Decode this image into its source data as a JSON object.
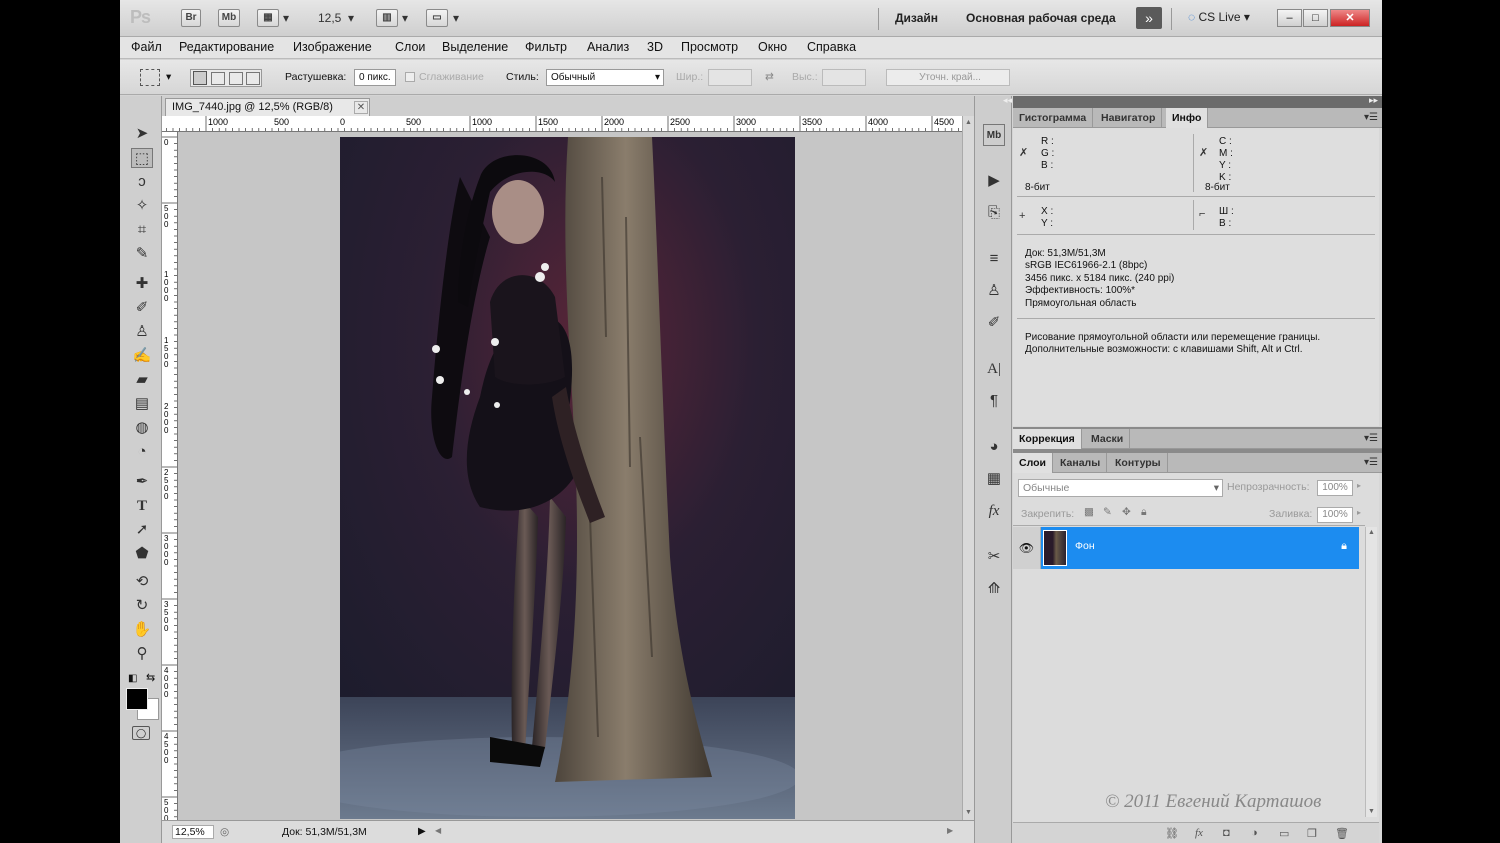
{
  "app": {
    "logo": "Ps",
    "bridge_label": "Br",
    "minibridge_label": "Mb",
    "zoom_dropdown": "12,5",
    "workspace_design": "Дизайн",
    "workspace_main": "Основная рабочая среда",
    "cslive_label": "CS Live"
  },
  "menu": [
    "Файл",
    "Редактирование",
    "Изображение",
    "Слои",
    "Выделение",
    "Фильтр",
    "Анализ",
    "3D",
    "Просмотр",
    "Окно",
    "Справка"
  ],
  "options": {
    "feather_label": "Растушевка:",
    "feather_value": "0 пикс.",
    "antialias_label": "Сглаживание",
    "style_label": "Стиль:",
    "style_value": "Обычный",
    "width_label": "Шир.:",
    "height_label": "Выс.:",
    "refine_label": "Уточн. край..."
  },
  "document": {
    "tab_title": "IMG_7440.jpg @ 12,5% (RGB/8)",
    "ruler_h_labels": [
      "1000",
      "500",
      "0",
      "500",
      "1000",
      "1500",
      "2000",
      "2500",
      "3000",
      "3500",
      "4000",
      "4500"
    ],
    "ruler_v_labels": [
      "0",
      "5\n0\n0",
      "1\n0\n0\n0",
      "1\n5\n0\n0",
      "2\n0\n0\n0",
      "2\n5\n0\n0",
      "3\n0\n0\n0",
      "3\n5\n0\n0",
      "4\n0\n0\n0",
      "4\n5\n0\n0",
      "5\n0\n0\n0"
    ],
    "status_zoom": "12,5%",
    "status_doc": "Док: 51,3M/51,3M"
  },
  "panels": {
    "info_tabs": [
      "Гистограмма",
      "Навигатор",
      "Инфо"
    ],
    "info": {
      "r": "R :",
      "g": "G :",
      "b": "B :",
      "c": "C :",
      "m": "M :",
      "y": "Y :",
      "k": "K :",
      "bits_left": "8-бит",
      "bits_right": "8-бит",
      "x": "X :",
      "y2": "Y :",
      "w": "Ш :",
      "h": "В :",
      "doc_line1": "Док: 51,3M/51,3M",
      "doc_line2": "sRGB IEC61966-2.1 (8bpc)",
      "doc_line3": "3456 пикс. x 5184 пикс. (240 ppi)",
      "doc_line4": "Эффективность: 100%*",
      "doc_line5": "Прямоугольная область",
      "hint_line1": "Рисование прямоугольной области или перемещение границы.",
      "hint_line2": "Дополнительные возможности: с клавишами Shift, Alt и Ctrl."
    },
    "adjust_tabs": [
      "Коррекция",
      "Маски"
    ],
    "layer_tabs": [
      "Слои",
      "Каналы",
      "Контуры"
    ],
    "layers": {
      "blend_mode": "Обычные",
      "opacity_label": "Непрозрачность:",
      "opacity_value": "100%",
      "lock_label": "Закрепить:",
      "fill_label": "Заливка:",
      "fill_value": "100%",
      "items": [
        {
          "name": "Фон"
        }
      ],
      "footer_icons": [
        "link-icon",
        "fx-icon",
        "mask-icon",
        "adjustment-icon",
        "group-icon",
        "new-layer-icon",
        "trash-icon"
      ]
    },
    "watermark": "© 2011 Евгений Карташов"
  },
  "colors": {
    "layer_selected": "#1c8cf0",
    "foreground": "#000000",
    "background": "#ffffff"
  }
}
